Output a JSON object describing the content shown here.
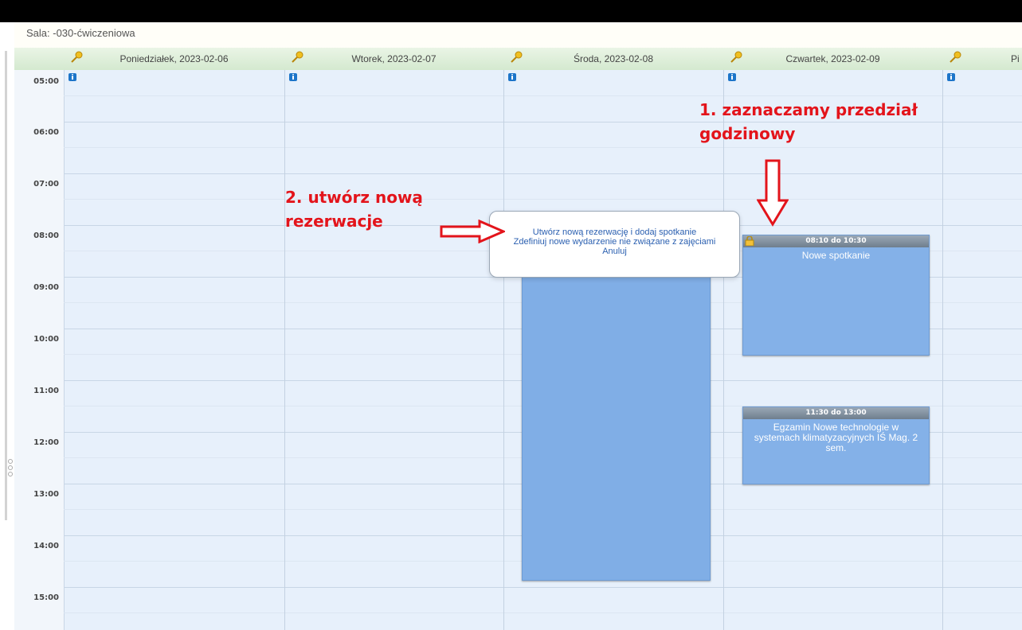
{
  "room": {
    "label": "Sala: -030-ćwiczeniowa"
  },
  "days": [
    {
      "label": "Poniedziałek, 2023-02-06"
    },
    {
      "label": "Wtorek, 2023-02-07"
    },
    {
      "label": "Środa, 2023-02-08"
    },
    {
      "label": "Czwartek, 2023-02-09"
    },
    {
      "label": "Pi"
    }
  ],
  "hours": [
    "05:00",
    "06:00",
    "07:00",
    "08:00",
    "09:00",
    "10:00",
    "11:00",
    "12:00",
    "13:00",
    "14:00",
    "15:00"
  ],
  "events": [
    {
      "time": "08:10 do 10:30",
      "title": "Nowe spotkanie"
    },
    {
      "time": "11:30 do 13:00",
      "title": "Egzamin Nowe technologie w systemach klimatyzacyjnych IŚ Mag. 2 sem."
    }
  ],
  "popup": {
    "create_reservation": "Utwórz nową rezerwację i dodaj spotkanie",
    "define_event": "Zdefiniuj nowe wydarzenie nie związane z zajęciami",
    "cancel": "Anuluj"
  },
  "annotations": {
    "step1_line1": "1. zaznaczamy przedział",
    "step1_line2": "godzinowy",
    "step2_line1": "2. utwórz nową",
    "step2_line2": "rezerwacje"
  },
  "colors": {
    "annotation": "#e3141b",
    "event": "#84b1e8",
    "link": "#2a5fb0",
    "header": "#d4e9cf"
  }
}
